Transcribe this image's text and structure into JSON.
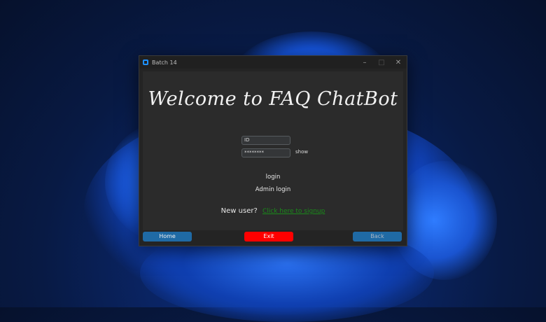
{
  "window": {
    "title": "Batch 14",
    "controls": {
      "minimize": "–",
      "maximize": "□",
      "close": "✕"
    }
  },
  "main": {
    "welcome": "Welcome to FAQ ChatBot",
    "id_field": {
      "value": "ID"
    },
    "password_field": {
      "value": "********"
    },
    "show_label": "show",
    "login_label": "login",
    "admin_login_label": "Admin login",
    "new_user_label": "New user?",
    "signup_link_label": "Click here to signup"
  },
  "footer": {
    "home_label": "Home",
    "exit_label": "Exit",
    "back_label": "Back"
  },
  "colors": {
    "accent": "#1f6aa5",
    "exit": "#ff0000",
    "link": "#1a8a1a"
  }
}
